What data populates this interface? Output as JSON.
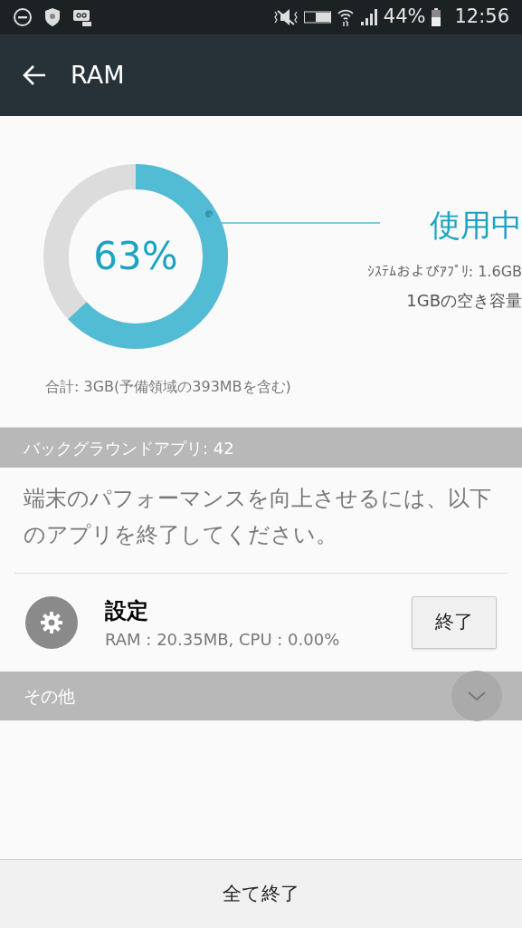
{
  "status_bar": {
    "battery": "44%",
    "time": "12:56"
  },
  "app_bar": {
    "title": "RAM"
  },
  "usage": {
    "level": 0.63,
    "percent": "63%",
    "label": "使用中",
    "system_apps": "ｼｽﾃﾑおよびｱﾌﾟﾘ: 1.6GB",
    "free": "1GBの空き容量",
    "total": "合計: 3GB(予備領域の393MBを含む)"
  },
  "background_apps": {
    "header": "バックグラウンドアプリ: 42",
    "description": "端末のパフォーマンスを向上させるには、以下のアプリを終了してください。",
    "apps": [
      {
        "name": "設定",
        "stats": "RAM : 20.35MB, CPU : 0.00%",
        "button": "終了"
      }
    ]
  },
  "others": {
    "header": "その他",
    "expanded": false
  },
  "bottom_button": "全て終了"
}
